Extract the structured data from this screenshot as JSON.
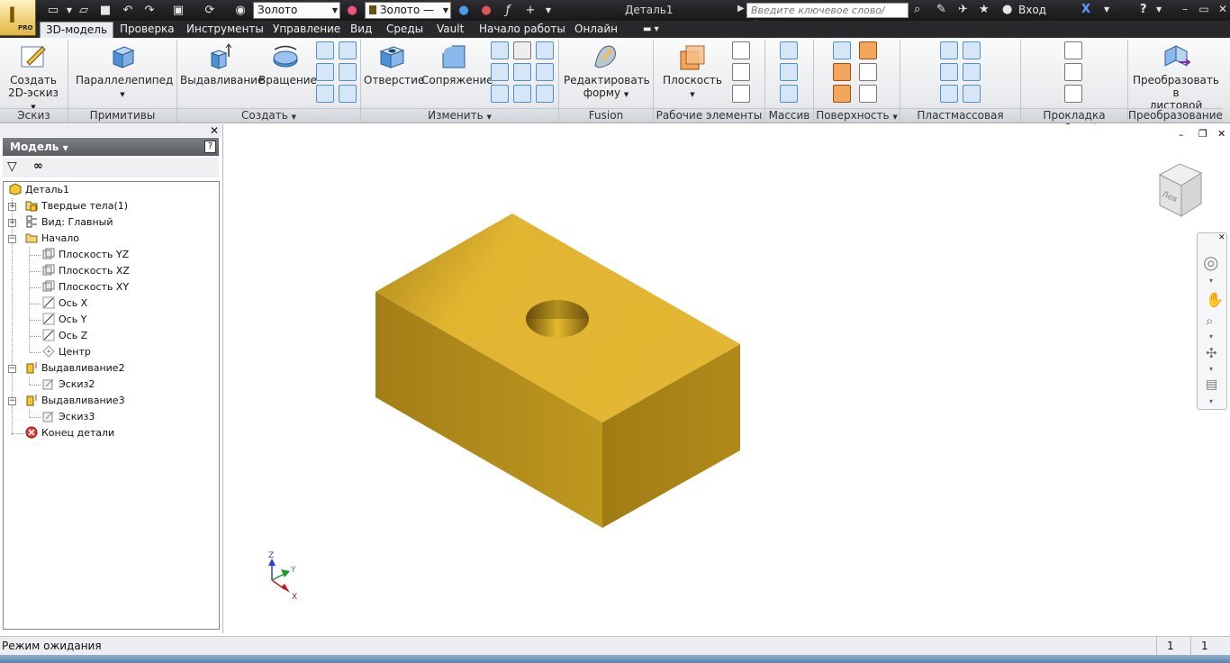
{
  "app": {
    "logo_badge": "PRO",
    "document_title": "Деталь1",
    "search_placeholder": "Введите ключевое слово/фразу",
    "login_label": "Вход",
    "material_combo": "Золото",
    "appearance_combo": "Золото —"
  },
  "tabs": [
    {
      "label": "3D-модель",
      "active": true
    },
    {
      "label": "Проверка"
    },
    {
      "label": "Инструменты"
    },
    {
      "label": "Управление"
    },
    {
      "label": "Вид"
    },
    {
      "label": "Среды"
    },
    {
      "label": "Vault"
    },
    {
      "label": "Начало работы"
    },
    {
      "label": "Онлайн"
    }
  ],
  "ribbon": {
    "sketch": {
      "button": "Создать\n2D-эскиз",
      "panel": "Эскиз"
    },
    "primitives": {
      "button": "Параллелепипед",
      "panel": "Примитивы"
    },
    "create": {
      "extrude": "Выдавливание",
      "revolve": "Вращение",
      "panel": "Создать"
    },
    "modify": {
      "hole": "Отверстие",
      "fillet": "Сопряжение",
      "panel": "Изменить"
    },
    "fusion": {
      "button": "Редактировать\nформу",
      "panel": "Fusion"
    },
    "work_features": {
      "button": "Плоскость",
      "panel": "Рабочие элементы"
    },
    "pattern": {
      "panel": "Массив"
    },
    "surface": {
      "panel": "Поверхность"
    },
    "plastic": {
      "panel": "Пластмассовая деталь"
    },
    "harness": {
      "panel": "Прокладка кабелей"
    },
    "convert": {
      "button": "Преобразовать в\nлистовой металл",
      "panel": "Преобразование"
    }
  },
  "browser": {
    "header": "Модель",
    "tree": [
      {
        "label": "Деталь1",
        "level": 0,
        "icon": "part-icon"
      },
      {
        "label": "Твердые тела(1)",
        "level": 1,
        "icon": "solid-bodies-icon",
        "expander": "+"
      },
      {
        "label": "Вид: Главный",
        "level": 1,
        "icon": "view-rep-icon",
        "expander": "+"
      },
      {
        "label": "Начало",
        "level": 1,
        "icon": "folder-icon",
        "expander": "−"
      },
      {
        "label": "Плоскость YZ",
        "level": 2,
        "icon": "plane-icon"
      },
      {
        "label": "Плоскость XZ",
        "level": 2,
        "icon": "plane-icon"
      },
      {
        "label": "Плоскость XY",
        "level": 2,
        "icon": "plane-icon"
      },
      {
        "label": "Ось X",
        "level": 2,
        "icon": "axis-icon"
      },
      {
        "label": "Ось Y",
        "level": 2,
        "icon": "axis-icon"
      },
      {
        "label": "Ось Z",
        "level": 2,
        "icon": "axis-icon"
      },
      {
        "label": "Центр",
        "level": 2,
        "icon": "point-icon"
      },
      {
        "label": "Выдавливание2",
        "level": 1,
        "icon": "extrude-icon",
        "expander": "−"
      },
      {
        "label": "Эскиз2",
        "level": 2,
        "icon": "sketch-icon"
      },
      {
        "label": "Выдавливание3",
        "level": 1,
        "icon": "extrude-icon",
        "expander": "−"
      },
      {
        "label": "Эскиз3",
        "level": 2,
        "icon": "sketch-icon"
      },
      {
        "label": "Конец детали",
        "level": 1,
        "icon": "end-of-part-icon"
      }
    ]
  },
  "viewport": {
    "view_cube_label": "Лев",
    "triad": {
      "x": "X",
      "y": "Y",
      "z": "Z"
    },
    "model_color": "#d9ad2b"
  },
  "status": {
    "text": "Режим ожидания",
    "count1": "1",
    "count2": "1"
  }
}
